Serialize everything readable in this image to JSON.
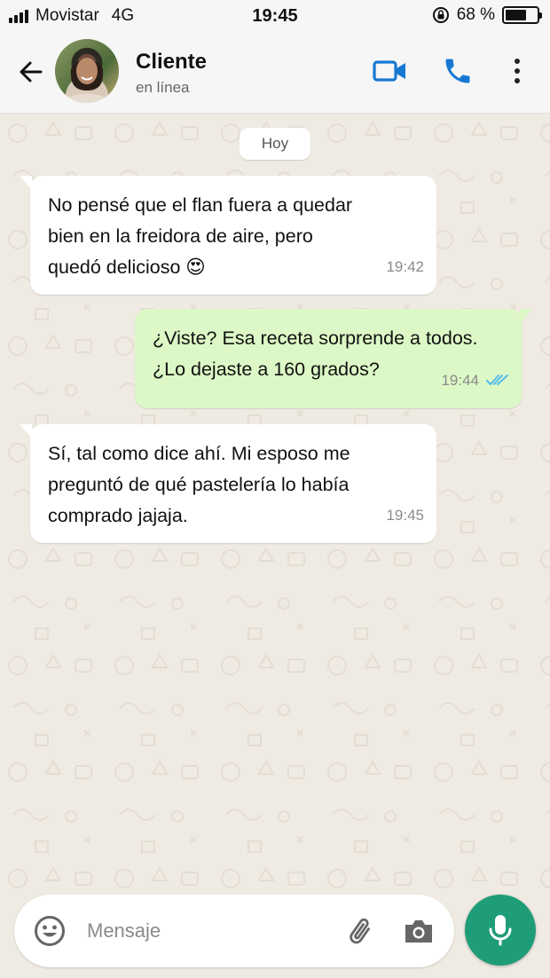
{
  "status_bar": {
    "carrier": "Movistar",
    "network": "4G",
    "time": "19:45",
    "battery_label": "68 %",
    "battery_level": 0.68
  },
  "header": {
    "contact_name": "Cliente",
    "contact_status": "en línea"
  },
  "chat": {
    "day_label": "Hoy",
    "messages": [
      {
        "direction": "in",
        "lines": [
          "No pensé que el flan fuera a quedar",
          "bien en la freidora de aire, pero",
          "quedó delicioso 😍"
        ],
        "time": "19:42"
      },
      {
        "direction": "out",
        "lines": [
          "¿Viste? Esa receta sorprende a todos.",
          "¿Lo dejaste a 160 grados?"
        ],
        "time": "19:44",
        "status_icon": "double-check-read-icon"
      },
      {
        "direction": "in",
        "lines": [
          "Sí, tal como dice ahí. Mi esposo me",
          "preguntó de qué pastelería lo había",
          "comprado jajaja."
        ],
        "time": "19:45"
      }
    ]
  },
  "composer": {
    "placeholder": "Mensaje",
    "value": ""
  },
  "colors": {
    "accent": "#1f9d78",
    "icon_blue": "#1778d2",
    "outgoing_bubble": "#dcf8c6",
    "incoming_bubble": "#ffffff",
    "read_ticks": "#53bdeb",
    "background": "#efeae2"
  },
  "icons": {
    "back": "arrow-left-icon",
    "video": "video-camera-icon",
    "call": "phone-icon",
    "menu": "more-vertical-icon",
    "emoji": "smiley-icon",
    "attach": "paperclip-icon",
    "camera": "camera-icon",
    "mic": "microphone-icon"
  }
}
